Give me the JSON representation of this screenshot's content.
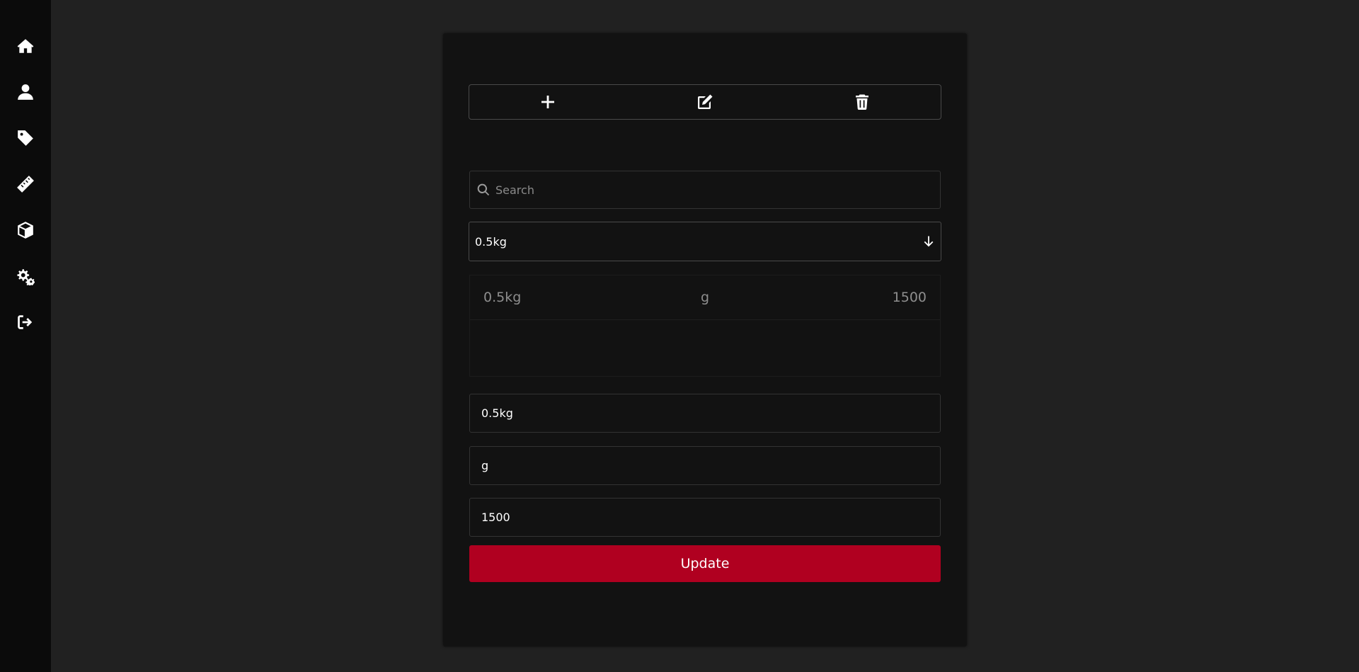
{
  "sidebar": {
    "items": [
      {
        "icon": "home-icon"
      },
      {
        "icon": "user-icon"
      },
      {
        "icon": "tag-icon"
      },
      {
        "icon": "ruler-icon"
      },
      {
        "icon": "box-icon"
      },
      {
        "icon": "gears-icon"
      },
      {
        "icon": "logout-icon"
      }
    ]
  },
  "toolbar": {
    "add_icon": "plus-icon",
    "edit_icon": "edit-icon",
    "delete_icon": "trash-icon"
  },
  "search": {
    "placeholder": "Search",
    "value": ""
  },
  "select": {
    "selected": "0.5kg"
  },
  "table": {
    "rows": [
      {
        "name": "0.5kg",
        "unit": "g",
        "value": "1500"
      }
    ]
  },
  "form": {
    "name": "0.5kg",
    "unit": "g",
    "value": "1500",
    "submit_label": "Update"
  },
  "colors": {
    "accent": "#b00020",
    "background": "#212121",
    "sidebar": "#0b0b0b",
    "card": "#121212"
  }
}
